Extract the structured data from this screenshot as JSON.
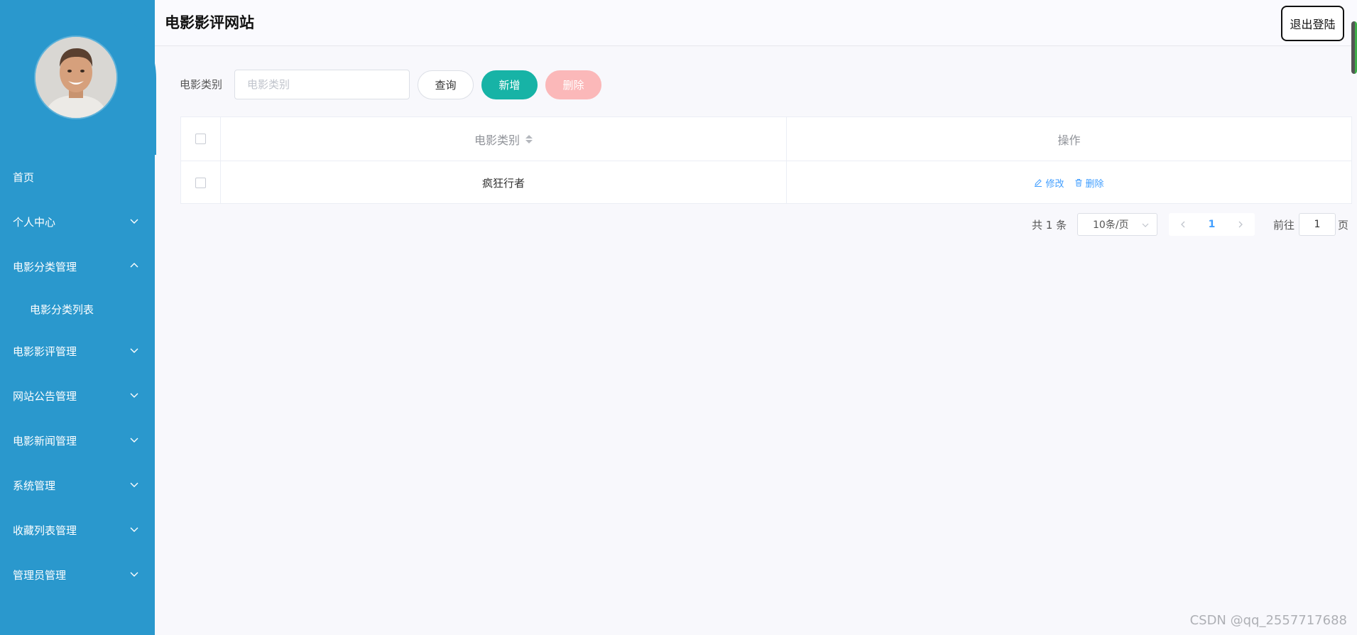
{
  "header": {
    "site_title": "电影影评网站",
    "logout_label": "退出登陆"
  },
  "sidebar": {
    "items": [
      {
        "label": "首页"
      },
      {
        "label": "个人中心"
      },
      {
        "label": "电影分类管理"
      },
      {
        "label": "电影影评管理"
      },
      {
        "label": "网站公告管理"
      },
      {
        "label": "电影新闻管理"
      },
      {
        "label": "系统管理"
      },
      {
        "label": "收藏列表管理"
      },
      {
        "label": "管理员管理"
      }
    ],
    "subitem_label": "电影分类列表"
  },
  "search": {
    "label": "电影类别",
    "placeholder": "电影类别",
    "query_label": "查询",
    "add_label": "新增",
    "delete_label": "删除"
  },
  "table": {
    "columns": [
      "电影类别",
      "操作"
    ],
    "rows": [
      {
        "category": "疯狂行者",
        "edit_label": "修改",
        "delete_label": "删除"
      }
    ]
  },
  "pagination": {
    "total_text": "共 1 条",
    "page_size": "10条/页",
    "current_page": "1",
    "goto_label": "前往",
    "goto_value": "1",
    "page_suffix": "页"
  },
  "watermark": "CSDN @qq_2557717688",
  "colors": {
    "sidebar": "#2a98cd",
    "add_button": "#17b3a6",
    "delete_button": "#fbb8b9",
    "link": "#409eff"
  }
}
